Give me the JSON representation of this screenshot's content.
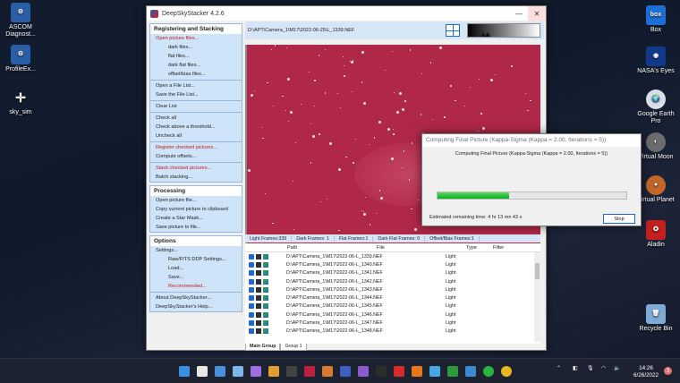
{
  "desktop_icons_left": [
    {
      "label": "ASCOM Diagnost...",
      "icon": "ascom-diagnostics-icon",
      "color": "#2a5fa8",
      "glyph": "⚙"
    },
    {
      "label": "ProfileEx...",
      "icon": "ascom-profile-explorer-icon",
      "color": "#2a5fa8",
      "glyph": "⚙"
    },
    {
      "label": "sky_sim",
      "icon": "sky-sim-icon",
      "color": "transparent",
      "glyph": "✛"
    }
  ],
  "desktop_icons_right": [
    {
      "label": "Box",
      "icon": "box-icon",
      "color": "#1b6fd6",
      "glyph": "box"
    },
    {
      "label": "NASA's Eyes",
      "icon": "nasa-eyes-icon",
      "color": "#123a8a",
      "glyph": "◉"
    },
    {
      "label": "Google Earth Pro",
      "icon": "google-earth-pro-icon",
      "color": "#d8dfe8",
      "glyph": "🌍"
    },
    {
      "label": "Virtual Moon",
      "icon": "virtual-moon-icon",
      "color": "#6c6c6c",
      "glyph": "◐"
    },
    {
      "label": "Virtual Planet",
      "icon": "virtual-planet-icon",
      "color": "#c2662a",
      "glyph": "●"
    },
    {
      "label": "Aladin",
      "icon": "aladin-icon",
      "color": "#c21f1f",
      "glyph": "✪"
    },
    {
      "label": "Recycle Bin",
      "icon": "recycle-bin-icon",
      "color": "#7eaad6",
      "glyph": "🗑"
    }
  ],
  "window": {
    "title": "DeepSkyStacker 4.2.6",
    "minimize": "—",
    "close": "✕"
  },
  "sidebar": {
    "registering": {
      "header": "Registering and Stacking",
      "items": [
        {
          "label": "Open picture files...",
          "style": "red"
        },
        {
          "label": "dark files...",
          "style": "sub"
        },
        {
          "label": "flat files...",
          "style": "sub"
        },
        {
          "label": "dark flat files...",
          "style": "sub"
        },
        {
          "label": "offset/bias files...",
          "style": "sub"
        },
        {
          "label": "Open a File List...",
          "style": ""
        },
        {
          "label": "Save the File List...",
          "style": ""
        },
        {
          "label": "Clear List",
          "style": ""
        },
        {
          "label": "Check all",
          "style": ""
        },
        {
          "label": "Check above a threshold...",
          "style": ""
        },
        {
          "label": "Uncheck all",
          "style": ""
        },
        {
          "label": "Register checked pictures...",
          "style": "red"
        },
        {
          "label": "Compute offsets...",
          "style": ""
        },
        {
          "label": "Stack checked pictures...",
          "style": "red"
        },
        {
          "label": "Batch stacking...",
          "style": ""
        }
      ]
    },
    "processing": {
      "header": "Processing",
      "items": [
        {
          "label": "Open picture file...",
          "style": ""
        },
        {
          "label": "Copy current picture to clipboard",
          "style": ""
        },
        {
          "label": "Create a Star Mask...",
          "style": ""
        },
        {
          "label": "Save picture to file...",
          "style": ""
        }
      ]
    },
    "options": {
      "header": "Options",
      "items": [
        {
          "label": "Settings...",
          "style": ""
        },
        {
          "label": "Raw/FITS DDP Settings...",
          "style": "sub"
        },
        {
          "label": "Load...",
          "style": "sub"
        },
        {
          "label": "Save...",
          "style": "sub"
        },
        {
          "label": "Recommended...",
          "style": "sub red"
        },
        {
          "label": "About DeepSkyStacker...",
          "style": ""
        },
        {
          "label": "DeepSkyStacker's Help...",
          "style": ""
        }
      ]
    }
  },
  "pathbar": {
    "path": "D:\\APT\\Camera_1\\M17\\2022-06-25\\L_1339.NEF"
  },
  "status": {
    "light": "Light Frames:339",
    "dark": "Dark Frames: 1",
    "flat": "Flat Frames:1",
    "darkflat": "Dark Flat Frames: 0",
    "offset": "Offset/Bias Frames:1"
  },
  "table": {
    "headers": {
      "path": "Path",
      "file": "File",
      "type": "Type",
      "filter": "Filter"
    },
    "rows": [
      {
        "path": "D:\\APT\\Camera_1\\M17\\2022-06-25\\",
        "file": "L_1339.NEF",
        "type": "Light"
      },
      {
        "path": "D:\\APT\\Camera_1\\M17\\2022-06-25\\",
        "file": "L_1340.NEF",
        "type": "Light"
      },
      {
        "path": "D:\\APT\\Camera_1\\M17\\2022-06-25\\",
        "file": "L_1341.NEF",
        "type": "Light"
      },
      {
        "path": "D:\\APT\\Camera_1\\M17\\2022-06-25\\",
        "file": "L_1342.NEF",
        "type": "Light"
      },
      {
        "path": "D:\\APT\\Camera_1\\M17\\2022-06-25\\",
        "file": "L_1343.NEF",
        "type": "Light"
      },
      {
        "path": "D:\\APT\\Camera_1\\M17\\2022-06-25\\",
        "file": "L_1344.NEF",
        "type": "Light"
      },
      {
        "path": "D:\\APT\\Camera_1\\M17\\2022-06-25\\",
        "file": "L_1345.NEF",
        "type": "Light"
      },
      {
        "path": "D:\\APT\\Camera_1\\M17\\2022-06-25\\",
        "file": "L_1346.NEF",
        "type": "Light"
      },
      {
        "path": "D:\\APT\\Camera_1\\M17\\2022-06-25\\",
        "file": "L_1347.NEF",
        "type": "Light"
      },
      {
        "path": "D:\\APT\\Camera_1\\M17\\2022-06-25\\",
        "file": "L_1348.NEF",
        "type": "Light"
      }
    ]
  },
  "tabs": [
    "Main Group",
    "Group 1"
  ],
  "dialog": {
    "title": "Computing Final Picture (Kappa-Sigma (Kappa = 2.00, Iterations = 5))",
    "message": "Computing Final Picture (Kappa-Sigma (Kappa = 2.00, Iterations = 5))",
    "progress": 0.38,
    "remaining": "Estimated remaining time: 4 hr 13 mn 43 s",
    "stop": "Stop"
  },
  "taskbar": {
    "time": "14:26",
    "date": "6/26/2022",
    "notifications": "3",
    "apps": [
      "windows-start-icon",
      "search-icon",
      "task-view-icon",
      "widgets-icon",
      "chat-icon",
      "sharpcap-icon",
      "stellarium-icon",
      "deepskystacker-icon",
      "app-icon",
      "pixinsight-icon",
      "ascom-icon",
      "astap-icon",
      "app-icon",
      "vlc-icon",
      "app-icon",
      "shield-icon",
      "app-icon",
      "whatsapp-icon",
      "chrome-icon"
    ]
  }
}
